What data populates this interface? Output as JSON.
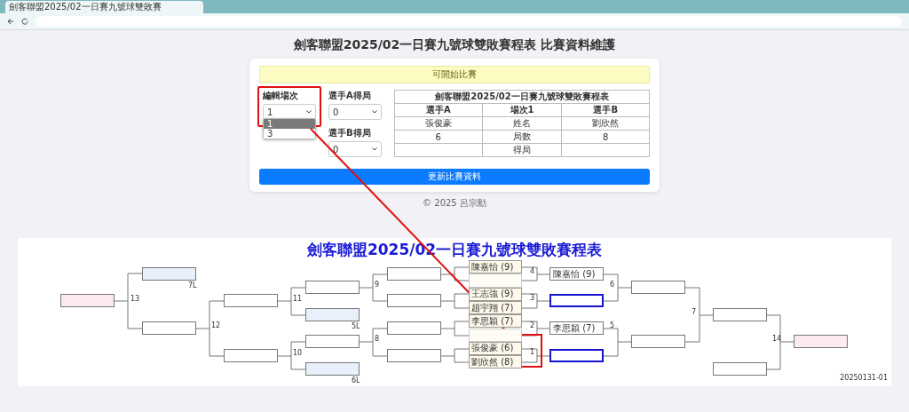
{
  "browser": {
    "tab_title": "劍客聯盟2025/02一日賽九號球雙敗賽"
  },
  "page_title": "劍客聯盟2025/02一日賽九號球雙敗賽程表 比賽資料維護",
  "status_banner": "可開始比賽",
  "form": {
    "match_label": "編輯場次",
    "match_value": "1",
    "match_options": [
      {
        "label": "1",
        "selected": true
      },
      {
        "label": "3",
        "selected": false
      }
    ],
    "score_a_label": "選手A得局",
    "score_a_value": "0",
    "score_b_label": "選手B得局",
    "score_b_value": "0"
  },
  "match_table": {
    "title": "劍客聯盟2025/02一日賽九號球雙敗賽程表",
    "header": [
      "選手A",
      "場次1",
      "選手B"
    ],
    "rows": [
      [
        "張俊豪",
        "姓名",
        "劉欣然"
      ],
      [
        "6",
        "局數",
        "8"
      ],
      [
        null,
        "得局",
        null
      ]
    ]
  },
  "submit_button": "更新比賽資料",
  "footer": "© 2025 呂宗勳",
  "bracket": {
    "title": "劍客聯盟2025/02一日賽九號球雙敗賽程表",
    "players": [
      {
        "name": "陳嘉怡 (9)"
      },
      {
        "faded": true
      },
      {
        "name": "王志強 (9)"
      },
      {
        "name": "趙宇翔 (7)"
      },
      {
        "name": "李思穎 (7)"
      },
      {
        "faded": true
      },
      {
        "name": "張俊豪 (6)"
      },
      {
        "name": "劉欣然 (8)"
      }
    ],
    "match_numbers": [
      "13",
      "12",
      "11",
      "10",
      "9",
      "8",
      "4",
      "3",
      "2",
      "1",
      "6",
      "5",
      "7",
      "14"
    ],
    "boxes": [
      {
        "kind": "final"
      },
      {
        "kind": "loser",
        "tag": "7L"
      },
      {
        "kind": "plain"
      },
      {
        "kind": "plain"
      },
      {
        "kind": "plain"
      },
      {
        "kind": "plain"
      },
      {
        "kind": "loser",
        "tag": "5L"
      },
      {
        "kind": "plain"
      },
      {
        "kind": "loser",
        "tag": "6L"
      },
      {
        "kind": "plain"
      },
      {
        "kind": "plain"
      },
      {
        "kind": "plain"
      },
      {
        "kind": "plain"
      },
      {
        "kind": "plain",
        "name": "陳嘉怡 (9)"
      },
      {
        "kind": "next"
      },
      {
        "kind": "plain",
        "name": "李思穎 (7)"
      },
      {
        "kind": "next"
      },
      {
        "kind": "plain"
      },
      {
        "kind": "plain"
      },
      {
        "kind": "plain"
      },
      {
        "kind": "plain"
      },
      {
        "kind": "final"
      }
    ],
    "code": "20250131-01"
  }
}
